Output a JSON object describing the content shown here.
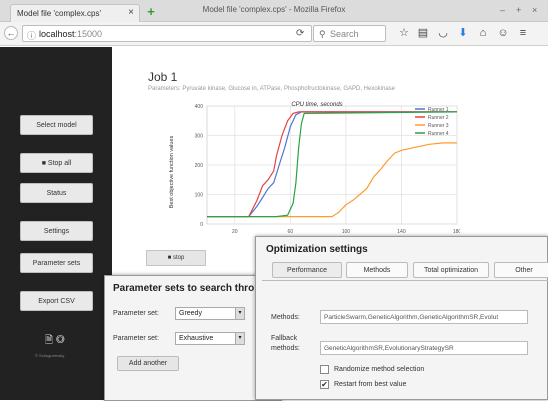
{
  "browser": {
    "window_title": "Model file 'complex.cps' - Mozilla Firefox",
    "tab_title": "Model file 'complex.cps'",
    "tab_close": "×",
    "new_tab": "+",
    "url_host": "localhost",
    "url_port": ":15000",
    "search_placeholder": "Search",
    "window_controls": [
      "–",
      "+",
      "×"
    ]
  },
  "sidebar": {
    "buttons": [
      "Select model",
      "Stop all",
      "Status",
      "Settings",
      "Parameter sets",
      "Export CSV"
    ],
    "copyright": "© Schugurensky"
  },
  "job": {
    "title": "Job 1",
    "parameters": "Parameters: Pyruvate kinase, Glucose in, ATPase, Phosphofructokinase, GAPD, Hexokinase",
    "stop_label": "stop"
  },
  "chart_data": {
    "type": "line",
    "title": "CPU time, seconds",
    "xlabel": "",
    "ylabel": "Best objective function values",
    "xlim": [
      0,
      180
    ],
    "ylim": [
      0,
      400
    ],
    "xticks": [
      20,
      60,
      100,
      140,
      180
    ],
    "yticks": [
      0,
      100,
      200,
      300,
      400
    ],
    "grid": true,
    "legend_position": "top-right",
    "series": [
      {
        "name": "Runner 1",
        "color": "#4a78d0",
        "x": [
          0,
          30,
          36,
          40,
          44,
          48,
          52,
          56,
          60,
          64,
          68,
          180
        ],
        "y": [
          25,
          25,
          60,
          90,
          120,
          140,
          200,
          260,
          330,
          370,
          380,
          380
        ]
      },
      {
        "name": "Runner 2",
        "color": "#e84040",
        "x": [
          0,
          30,
          36,
          40,
          44,
          48,
          50,
          54,
          58,
          62,
          66,
          180
        ],
        "y": [
          25,
          25,
          80,
          130,
          150,
          180,
          230,
          300,
          350,
          375,
          380,
          380
        ]
      },
      {
        "name": "Runner 3",
        "color": "#ff9a30",
        "x": [
          0,
          90,
          95,
          100,
          105,
          110,
          115,
          120,
          125,
          130,
          135,
          140,
          150,
          160,
          170,
          180
        ],
        "y": [
          25,
          25,
          40,
          65,
          80,
          100,
          120,
          160,
          185,
          215,
          240,
          250,
          260,
          270,
          275,
          275
        ]
      },
      {
        "name": "Runner 4",
        "color": "#2aa14a",
        "x": [
          0,
          50,
          58,
          62,
          64,
          66,
          68,
          70,
          180
        ],
        "y": [
          25,
          25,
          30,
          70,
          140,
          260,
          340,
          375,
          380
        ]
      }
    ]
  },
  "param_sets_dialog": {
    "title": "Parameter sets to search thro",
    "rows": [
      {
        "label": "Parameter set:",
        "value": "Greedy"
      },
      {
        "label": "Parameter set:",
        "value": "Exhaustive"
      }
    ],
    "add_label": "Add another"
  },
  "opt_dialog": {
    "title": "Optimization settings",
    "tabs": [
      "Performance",
      "Methods",
      "Total optimization",
      "Other"
    ],
    "methods_label": "Methods:",
    "methods_value": "ParticleSwarm,GeneticAlgorithm,GeneticAlgorithmSR,Evolut",
    "fallback_label_1": "Fallback",
    "fallback_label_2": "methods:",
    "fallback_value": "GeneticAlgorithmSR,EvolutionaryStrategySR",
    "randomize_label": "Randomize method selection",
    "restart_label": "Restart from best value",
    "randomize_checked": false,
    "restart_checked": true
  }
}
